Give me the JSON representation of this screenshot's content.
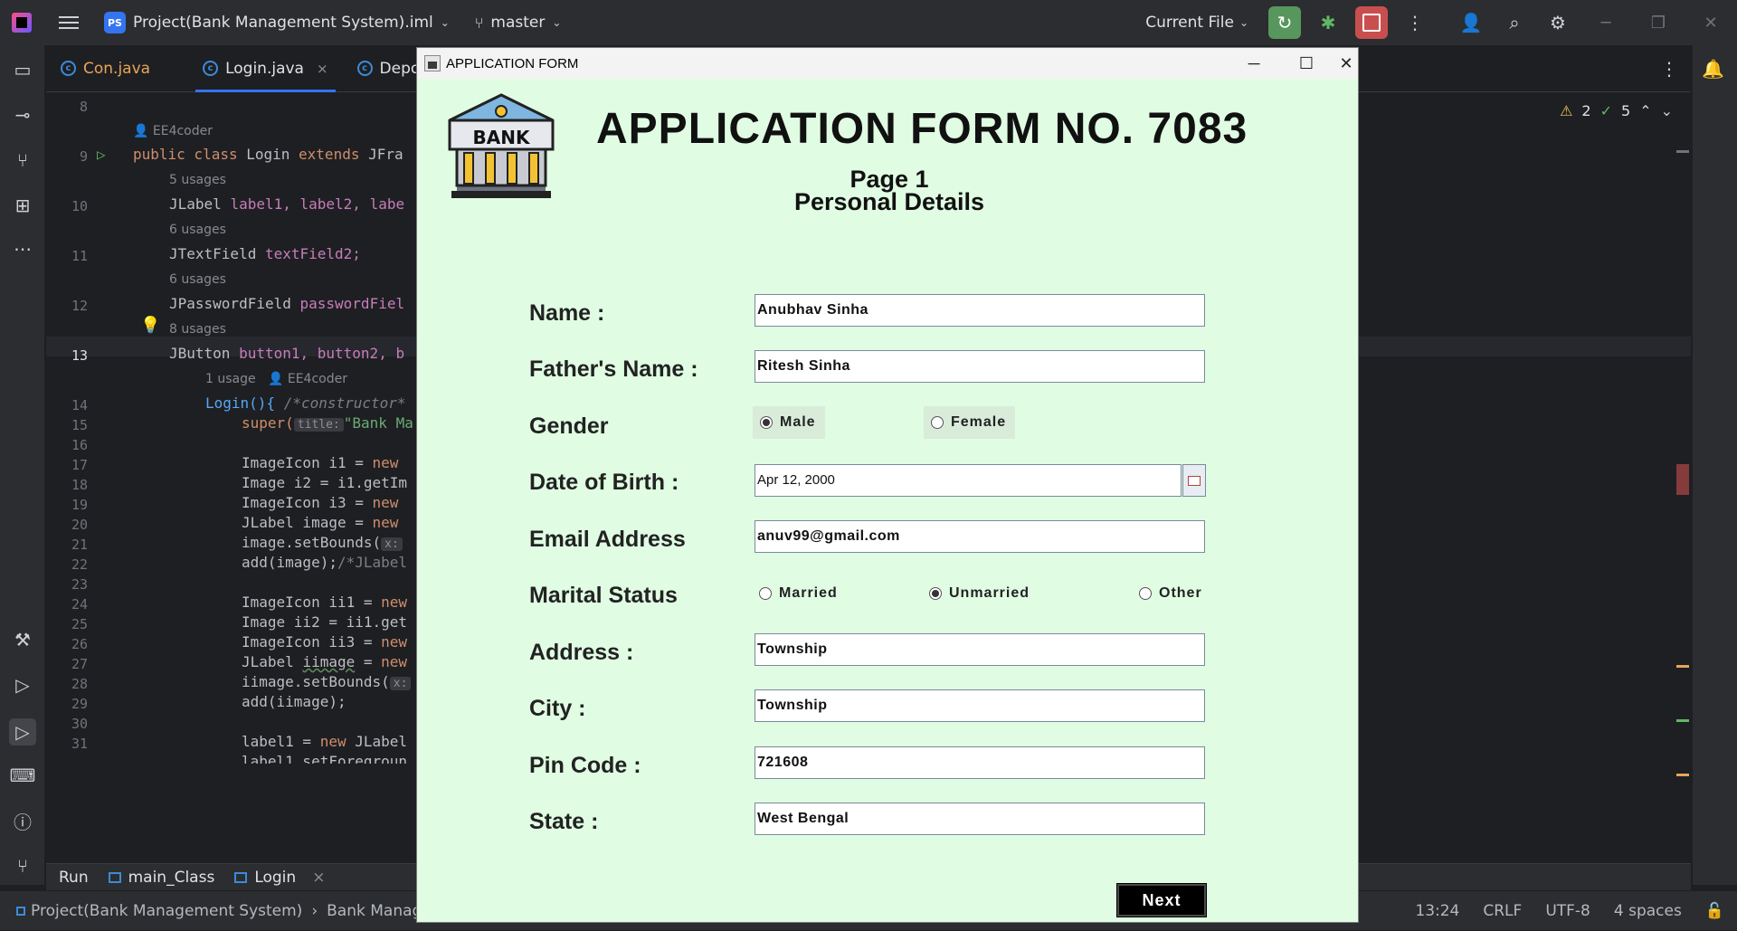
{
  "ide": {
    "project": "Project(Bank Management System).iml",
    "project_badge": "PS",
    "branch": "master",
    "run_config": "Current File",
    "warnings": "2",
    "checks": "5",
    "tabs": [
      {
        "label": "Con.java"
      },
      {
        "label": "Login.java"
      },
      {
        "label": "Deposit"
      }
    ],
    "tab_close": "×",
    "gutter": [
      "8",
      "9",
      "10",
      "11",
      "12",
      "13",
      "14",
      "15",
      "16",
      "17",
      "18",
      "19",
      "20",
      "21",
      "22",
      "23",
      "24",
      "25",
      "26",
      "27",
      "28",
      "29",
      "30",
      "31"
    ],
    "hints": {
      "author1": "EE4coder",
      "usages5": "5 usages",
      "usages6a": "6 usages",
      "usages6b": "6 usages",
      "usages8": "8 usages",
      "usage1": "1 usage",
      "author2": "EE4coder"
    },
    "code": {
      "l9a": "public class ",
      "l9b": "Login ",
      "l9c": "extends ",
      "l9d": "JFra",
      "l10a": "JLabel ",
      "l10b": "label1, label2, labe",
      "l11a": "JTextField ",
      "l11b": "textField2;",
      "l12a": "JPasswordField ",
      "l12b": "passwordFiel",
      "l13a": "JButton ",
      "l13b": "button1, button2, b",
      "l14a": "Login(){ ",
      "l14b": "/*constructor*",
      "l15a": "super(",
      "l15b": "title:",
      "l15c": "\"Bank Ma",
      "l17a": "ImageIcon i1 = ",
      "l17b": "new",
      "l18": "Image i2 = i1.getIm",
      "l19a": "ImageIcon i3 = ",
      "l19b": "new",
      "l20a": "JLabel image = ",
      "l20b": "new",
      "l21a": "image.setBounds(",
      "l21b": "x:",
      "l22a": "add(image);",
      "l22b": "/*JLabel",
      "l24a": "ImageIcon ii1 = ",
      "l24b": "new",
      "l25": "Image ii2 = ii1.get",
      "l26a": "ImageIcon ii3 = ",
      "l26b": "new",
      "l27a": "JLabel ",
      "l27b": "iimage",
      "l27c": " = ",
      "l27d": "new",
      "l28a": "iimage.setBounds(",
      "l28b": "x:",
      "l29": "add(iimage);",
      "l31a": "label1 = ",
      "l31b": "new ",
      "l31c": "JLabel",
      "l32": "label1.setForegroun"
    },
    "run_bar": {
      "run": "Run",
      "tab1": "main_Class",
      "tab2": "Login"
    },
    "status": {
      "breadcrumb1": "Project(Bank Management System)",
      "breadcrumb2": "Bank Managemen",
      "position": "13:24",
      "line_sep": "CRLF",
      "encoding": "UTF-8",
      "indent": "4 spaces"
    }
  },
  "form": {
    "window_title": "APPLICATION FORM",
    "logo_text": "BANK",
    "heading": "APPLICATION FORM NO. 7083",
    "page": "Page 1",
    "section": "Personal Details",
    "labels": {
      "name": "Name :",
      "father": "Father's Name :",
      "gender": "Gender",
      "dob": "Date of Birth :",
      "email": "Email Address",
      "marital": "Marital Status",
      "address": "Address :",
      "city": "City :",
      "pin": "Pin Code :",
      "state": "State :"
    },
    "values": {
      "name": "Anubhav Sinha",
      "father": "Ritesh Sinha",
      "dob": "Apr 12, 2000",
      "email": "anuv99@gmail.com",
      "address": "Township",
      "city": "Township",
      "pin": "721608",
      "state": "West Bengal"
    },
    "gender_options": {
      "male": "Male",
      "female": "Female",
      "selected": "Male"
    },
    "marital_options": {
      "married": "Married",
      "unmarried": "Unmarried",
      "other": "Other",
      "selected": "Unmarried"
    },
    "next_label": "Next"
  },
  "colors": {
    "form_background": "#e0fde3",
    "ide_background": "#1e1f22",
    "accent": "#3574f0"
  }
}
